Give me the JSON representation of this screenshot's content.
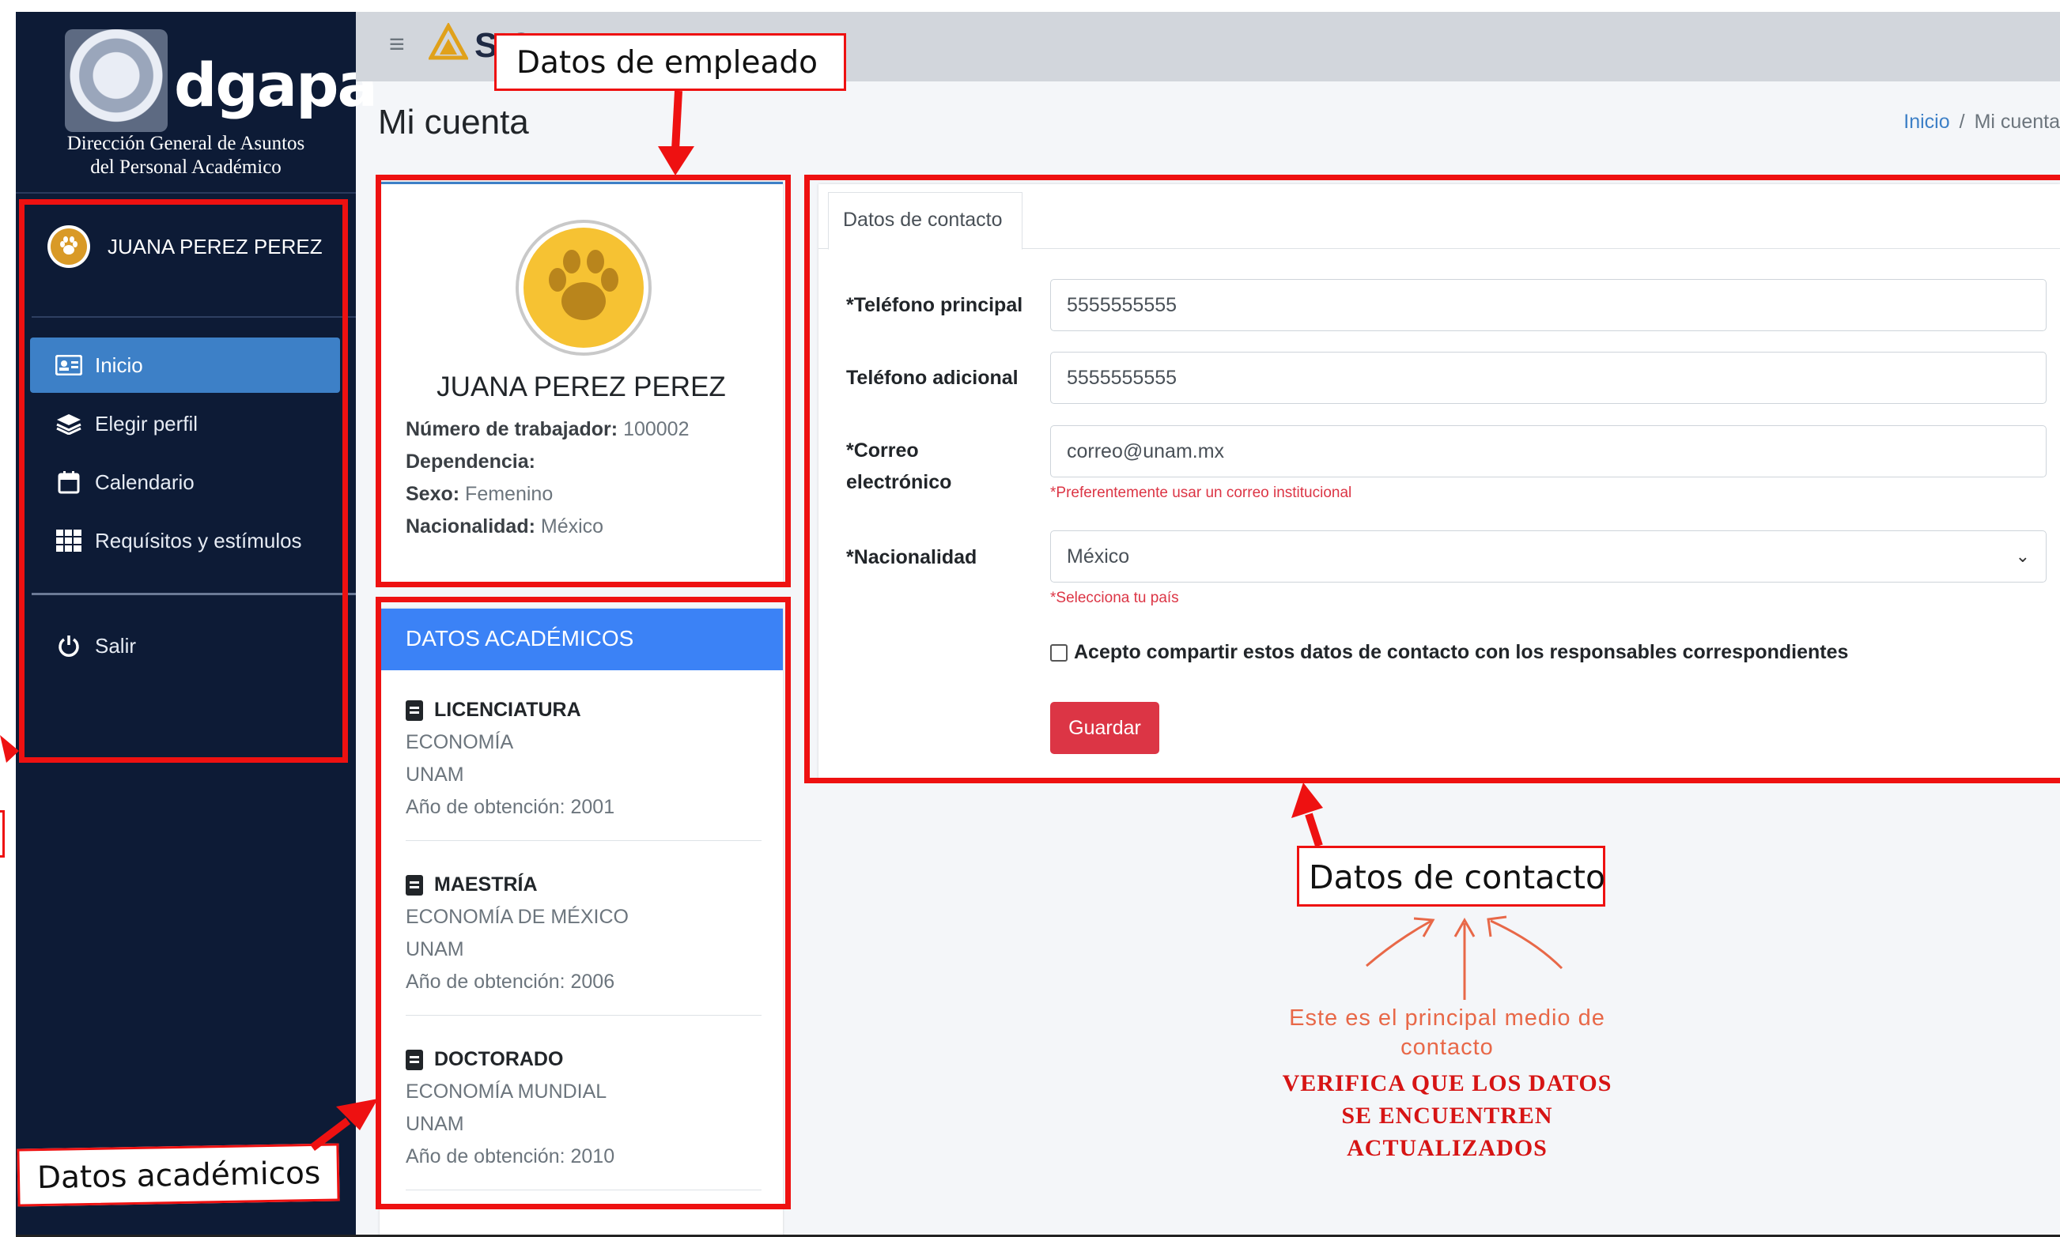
{
  "sidebar": {
    "logo_text": "dgapa",
    "caption": [
      "Dirección General de Asuntos",
      "del Personal Académico"
    ],
    "user_name": "JUANA PEREZ PEREZ",
    "nav": [
      {
        "label": "Inicio",
        "icon": "id-card-icon",
        "active": true
      },
      {
        "label": "Elegir perfil",
        "icon": "layers-icon",
        "active": false
      },
      {
        "label": "Calendario",
        "icon": "calendar-icon",
        "active": false
      },
      {
        "label": "Requísitos y estímulos",
        "icon": "grid-icon",
        "active": false
      }
    ],
    "logout_label": "Salir"
  },
  "topbar": {
    "app_name": "SIG"
  },
  "page": {
    "title": "Mi cuenta",
    "breadcrumb": {
      "home": "Inicio",
      "separator": "/",
      "current": "Mi cuenta"
    }
  },
  "profile": {
    "name": "JUANA PEREZ PEREZ",
    "details": [
      {
        "label": "Número de trabajador:",
        "value": "100002"
      },
      {
        "label": "Dependencia:",
        "value": ""
      },
      {
        "label": "Sexo:",
        "value": "Femenino"
      },
      {
        "label": "Nacionalidad:",
        "value": "México"
      }
    ]
  },
  "academic": {
    "header": "DATOS ACADÉMICOS",
    "degrees": [
      {
        "level": "LICENCIATURA",
        "field": "ECONOMÍA",
        "institution": "UNAM",
        "year_text": "Año de obtención: 2001"
      },
      {
        "level": "MAESTRÍA",
        "field": "ECONOMÍA DE MÉXICO",
        "institution": "UNAM",
        "year_text": "Año de obtención: 2006"
      },
      {
        "level": "DOCTORADO",
        "field": "ECONOMÍA MUNDIAL",
        "institution": "UNAM",
        "year_text": "Año de obtención: 2010"
      }
    ]
  },
  "contact": {
    "tab_label": "Datos de contacto",
    "phone_label": "*Teléfono principal",
    "phone_value": "5555555555",
    "phone2_label": "Teléfono adicional",
    "phone2_value": "5555555555",
    "email_label_1": "*Correo",
    "email_label_2": "electrónico",
    "email_value": "correo@unam.mx",
    "email_help": "*Preferentemente usar un correo institucional",
    "nationality_label": "*Nacionalidad",
    "nationality_value": "México",
    "nationality_help": "*Selecciona tu país",
    "consent_label": "Acepto compartir estos datos de contacto con los responsables correspondientes",
    "save_label": "Guardar"
  },
  "annotations": {
    "employee_label": "Datos de empleado",
    "contact_label": "Datos de contacto",
    "academic_label": "Datos académicos",
    "note_line": "Este es el principal medio de contacto",
    "warning_lines": [
      "VERIFICA QUE LOS DATOS",
      "SE ENCUENTREN",
      "ACTUALIZADOS"
    ],
    "highlight_color": "#ee1111"
  }
}
